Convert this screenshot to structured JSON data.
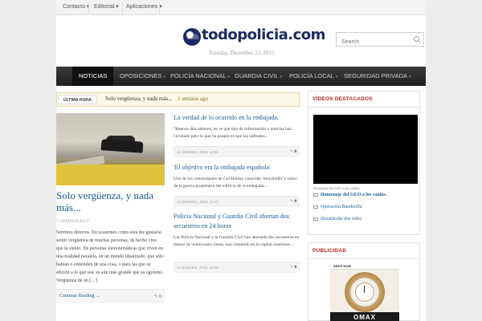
{
  "topbar": {
    "items": [
      "Contacto ▾",
      "Editorial ▾",
      "Aplicaciones ▾"
    ]
  },
  "header": {
    "logo_text": "todopolicia.com",
    "date": "Tuesday, December 22, 2015",
    "search_placeholder": "Search"
  },
  "nav": {
    "items": [
      {
        "label": "NOTICIAS",
        "arrow": "▾"
      },
      {
        "label": "OPOSICIONES",
        "arrow": "▾"
      },
      {
        "label": "POLICÍA NACIONAL",
        "arrow": "▾"
      },
      {
        "label": "GUARDIA CIVIL",
        "arrow": "▾"
      },
      {
        "label": "POLICÍA LOCAL",
        "arrow": "▾"
      },
      {
        "label": "SEGURIDAD PRIVADA",
        "arrow": "▾"
      }
    ]
  },
  "ticker": {
    "label": "ÚLTIMA HORA:",
    "headline": "Solo vergüenza, y nada más...",
    "time": "1 semana ago"
  },
  "featured": {
    "title": "Solo vergüenza, y nada más...",
    "time": "1 SEMANA AGO",
    "excerpt": "Seremos directos. En ocasiones como esta me gustaría sentir vergüenza de muchas personas, de hecho creo que la siento. De personas monotemáticas que viven en una realidad paralela, en un mundo idealizado, que sólo hablan o entienden de una cosa, o para las que su afición a lo que sea, es aún más grande que su egoísmo. Vergüenza de un […]",
    "continue": "Continue Reading →",
    "comments": "0"
  },
  "articles": [
    {
      "title": "La verdad de lo ocurrido en la embajada.",
      "excerpt": "\"Buenos días señores, no se que tipo de información o noticias han circulado pero lo que ha pasado es que los talibanes...",
      "date": "12 diciembre, 2015, 12:51",
      "comments": "0"
    },
    {
      "title": "'El objetivo era la embajada española'",
      "excerpt": "Uno de los comandantes de Gul Haidar, conocido 'muyahidín' y señor de la guerra propietario del edificio de la embajada...",
      "date": "12 diciembre, 2015, 12:47",
      "comments": "0"
    },
    {
      "title": "Policía Nacional y Guardia Civil abortan dos secuestros en 24 horas",
      "excerpt": "Las Policía Nacional y la Guardia Civil han abortado dos secuestros en menos de veinticuatro horas, uno cometido en la capital onubense...",
      "date": "11 diciembre, 2015, 18:08",
      "comments": "0"
    }
  ],
  "sidebar": {
    "videos_title": "VÍDEOS DESTACADOS",
    "video_caption": "Homenaje del GEO a los caídos.",
    "video_links": [
      "Homenaje del GEO a los caídos.",
      "Operación Banderilla",
      "Desarticula dos redes"
    ],
    "ad_title": "PUBLICIDAD",
    "ad_top": "SHOP NOW",
    "ad_brand": "OMAX"
  },
  "colors": {
    "link": "#1f5b8c",
    "section_title": "#b3261e",
    "nav_bg": "#222222",
    "logo": "#1c2a63"
  }
}
